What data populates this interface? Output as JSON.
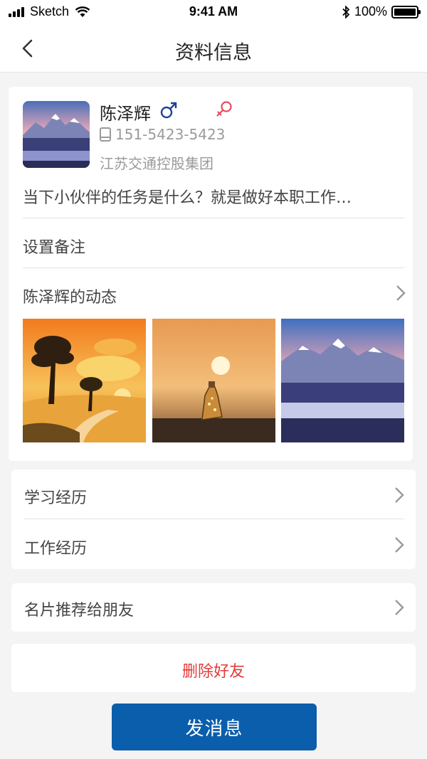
{
  "status_bar": {
    "carrier": "Sketch",
    "time": "9:41 AM",
    "battery": "100%",
    "battery_level": 1.0
  },
  "nav": {
    "title": "资料信息",
    "back_icon": "chevron-left-icon"
  },
  "profile": {
    "name": "陈泽辉",
    "phone": "151-5423-5423",
    "company": "江苏交通控股集团",
    "signature": "当下小伙伴的任务是什么？就是做好本职工作…",
    "male_color": "#1d3f9a",
    "female_color": "#e84a5f"
  },
  "rows": {
    "remark": "设置备注",
    "moments": "陈泽辉的动态",
    "study": "学习经历",
    "work": "工作经历",
    "share": "名片推荐给朋友",
    "delete": "删除好友"
  },
  "send_button": "发消息",
  "colors": {
    "accent": "#0b5eab",
    "danger": "#e23b3b"
  }
}
